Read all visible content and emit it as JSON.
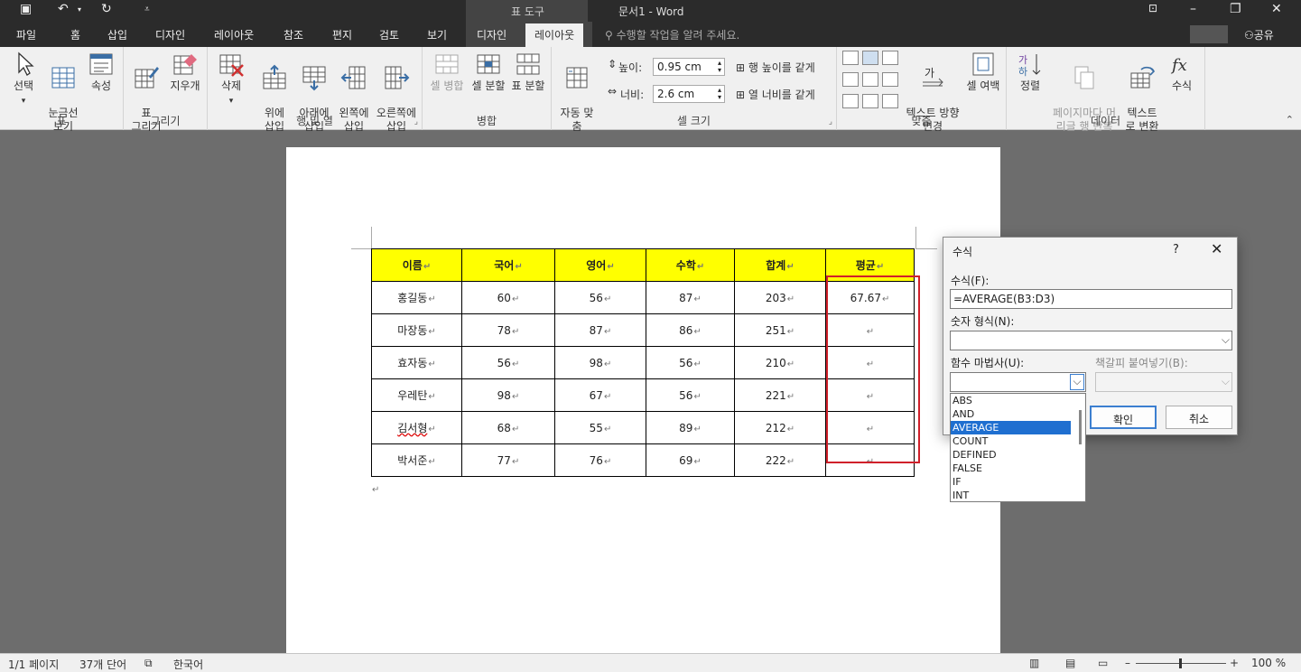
{
  "titlebar": {
    "context_label": "표 도구",
    "doc_title": "문서1 - Word"
  },
  "tabs": [
    {
      "label": "파일"
    },
    {
      "label": "홈"
    },
    {
      "label": "삽입"
    },
    {
      "label": "디자인"
    },
    {
      "label": "레이아웃"
    },
    {
      "label": "참조"
    },
    {
      "label": "편지"
    },
    {
      "label": "검토"
    },
    {
      "label": "보기"
    },
    {
      "label": "디자인"
    },
    {
      "label": "레이아웃"
    }
  ],
  "tellme": "수행할 작업을 알려 주세요.",
  "share": "공유",
  "ribbon": {
    "table": {
      "label": "표",
      "select": "선택",
      "gridlines": "눈금선\n보기",
      "properties": "속성"
    },
    "draw": {
      "label": "그리기",
      "draw_table": "표\n그리기",
      "eraser": "지우개"
    },
    "rows_cols": {
      "label": "행 및 열",
      "delete": "삭제",
      "insert_above": "위에\n삽입",
      "insert_below": "아래에\n삽입",
      "insert_left": "왼쪽에\n삽입",
      "insert_right": "오른쪽에\n삽입"
    },
    "merge": {
      "label": "병합",
      "merge_cells": "셀 병합",
      "split_cells": "셀 분할",
      "split_table": "표 분할"
    },
    "cell_size": {
      "label": "셀 크기",
      "autofit": "자동 맞\n춤",
      "height_label": "높이:",
      "height_value": "0.95 cm",
      "width_label": "너비:",
      "width_value": "2.6 cm",
      "distribute_rows": "행 높이를 같게",
      "distribute_cols": "열 너비를 같게"
    },
    "alignment": {
      "label": "맞춤",
      "text_direction": "텍스트 방향\n변경",
      "cell_margins": "셀 여백"
    },
    "data": {
      "label": "데이터",
      "sort": "정렬",
      "repeat_header": "페이지마다 머\n리글 행 반복",
      "convert": "텍스트\n로 변환",
      "formula": "수식"
    }
  },
  "table": {
    "headers": [
      "이름",
      "국어",
      "영어",
      "수학",
      "합계",
      "평균"
    ],
    "rows": [
      [
        "홍길동",
        "60",
        "56",
        "87",
        "203",
        "67.67"
      ],
      [
        "마장동",
        "78",
        "87",
        "86",
        "251",
        ""
      ],
      [
        "효자동",
        "56",
        "98",
        "56",
        "210",
        ""
      ],
      [
        "우레탄",
        "98",
        "67",
        "56",
        "221",
        ""
      ],
      [
        "김서형",
        "68",
        "55",
        "89",
        "212",
        ""
      ],
      [
        "박서준",
        "77",
        "76",
        "69",
        "222",
        ""
      ]
    ]
  },
  "dialog": {
    "title": "수식",
    "help": "?",
    "formula_label": "수식(F):",
    "formula_value": "=AVERAGE(B3:D3)",
    "number_format_label": "숫자 형식(N):",
    "paste_function_label": "함수 마법사(U):",
    "paste_bookmark_label": "책갈피 붙여넣기(B):",
    "ok": "확인",
    "cancel": "취소",
    "functions": [
      "ABS",
      "AND",
      "AVERAGE",
      "COUNT",
      "DEFINED",
      "FALSE",
      "IF",
      "INT"
    ],
    "selected_function": "AVERAGE"
  },
  "status": {
    "page": "1/1 페이지",
    "words": "37개 단어",
    "language": "한국어",
    "zoom": "100 %"
  },
  "colors": {
    "header_fill": "#ffff00",
    "highlight_box": "#d0202a",
    "selection": "#1f6fd0"
  }
}
